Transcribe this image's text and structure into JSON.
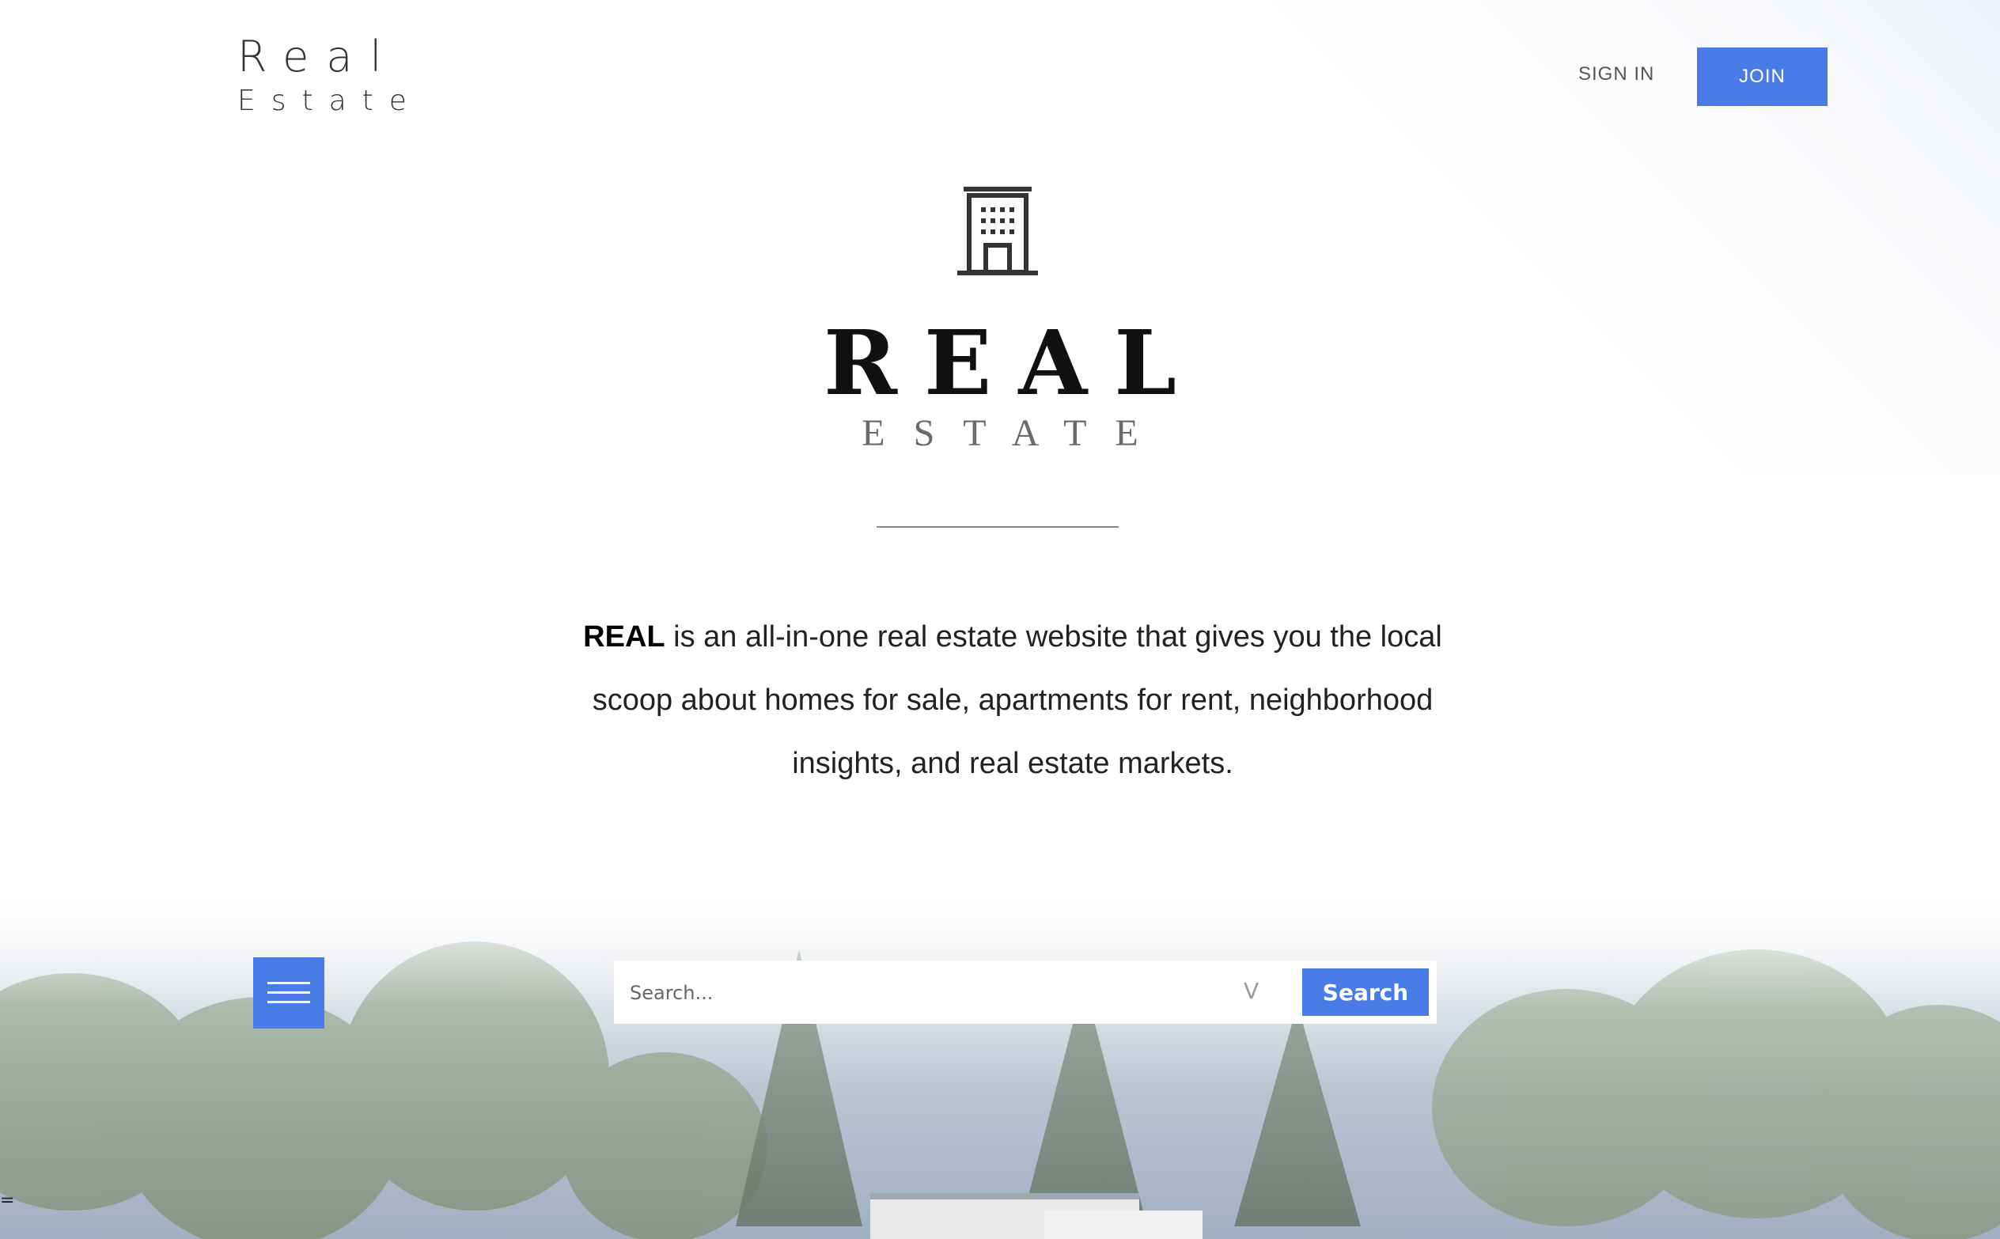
{
  "brand": {
    "line1": "Real",
    "line2": "Estate"
  },
  "nav": {
    "signin": "SIGN IN",
    "join": "JOIN"
  },
  "hero_logo": {
    "icon": "building-icon",
    "title": "REAL",
    "subtitle": "ESTATE"
  },
  "intro": {
    "bold": "REAL",
    "text": " is an all-in-one real estate website that gives you the local scoop about homes for sale, apartments for rent, neighborhood insights, and real estate markets."
  },
  "search": {
    "placeholder": "Search...",
    "dropdown_glyph": "V",
    "button": "Search"
  },
  "menu": {
    "icon": "hamburger-menu-icon"
  },
  "edge_mark": "=",
  "colors": {
    "accent": "#4a7ce8",
    "text": "#222222",
    "muted": "#6a6a6a"
  }
}
